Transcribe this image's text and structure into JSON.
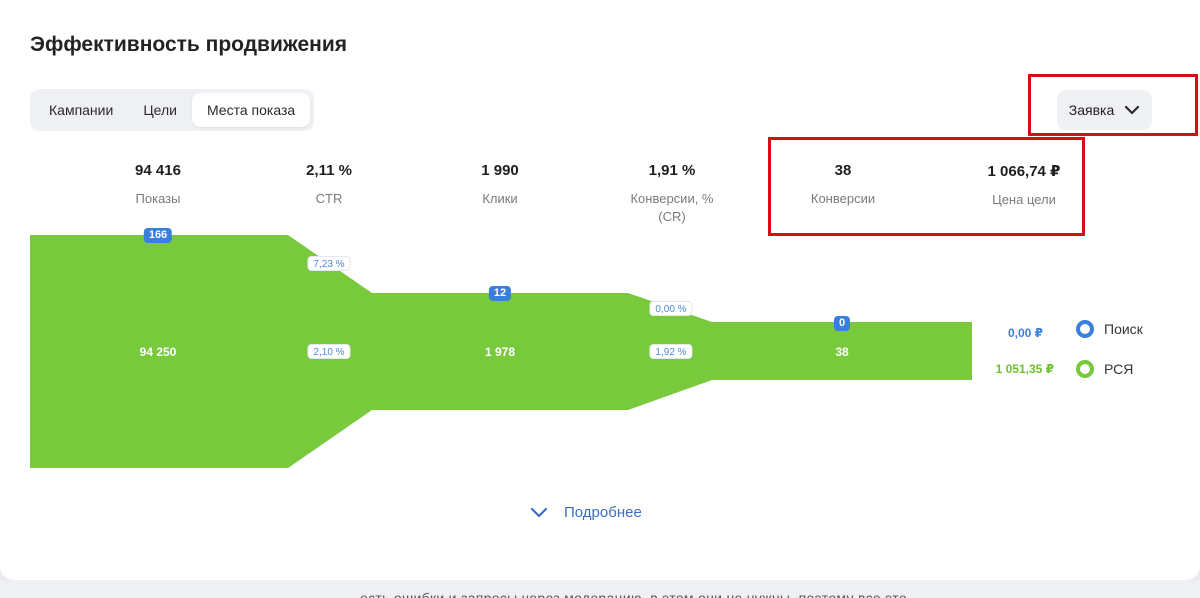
{
  "title": "Эффективность продвижения",
  "tabs": [
    {
      "label": "Кампании",
      "active": false
    },
    {
      "label": "Цели",
      "active": false
    },
    {
      "label": "Места показа",
      "active": true
    }
  ],
  "goal_dropdown": {
    "selected": "Заявка",
    "icon": "chevron-down-icon"
  },
  "metrics": [
    {
      "value": "94 416",
      "label": "Показы"
    },
    {
      "value": "2,11 %",
      "label": "CTR"
    },
    {
      "value": "1 990",
      "label": "Клики"
    },
    {
      "value": "1,91 %",
      "label": "Конверсии, % (CR)"
    },
    {
      "value": "38",
      "label": "Конверсии"
    },
    {
      "value": "1 066,74 ₽",
      "label": "Цена цели"
    }
  ],
  "funnel": {
    "segments": [
      {
        "search_value": "166",
        "total_value": "94 250"
      },
      {
        "search_value": "12",
        "total_value": "1 978"
      },
      {
        "search_value": "0",
        "total_value": "38"
      }
    ],
    "transitions": [
      {
        "search_rate": "7,23 %",
        "total_rate": "2,10 %"
      },
      {
        "search_rate": "0,00 %",
        "total_rate": "1,92 %"
      }
    ],
    "side_values": {
      "search": "0,00 ₽",
      "network": "1 051,35 ₽"
    }
  },
  "legend": [
    {
      "label": "Поиск",
      "color": "#3a7fdb"
    },
    {
      "label": "РСЯ",
      "color": "#78c93b"
    }
  ],
  "colors": {
    "funnel_green": "#78c93b",
    "accent_blue": "#3a7fdb",
    "highlight_red": "#d90d16"
  },
  "more_link": {
    "label": "Подробнее",
    "icon": "chevron-down-icon"
  },
  "footer_text": "есть ошибки и запросы через модерацию, в этом они не нужны, поэтому все это"
}
